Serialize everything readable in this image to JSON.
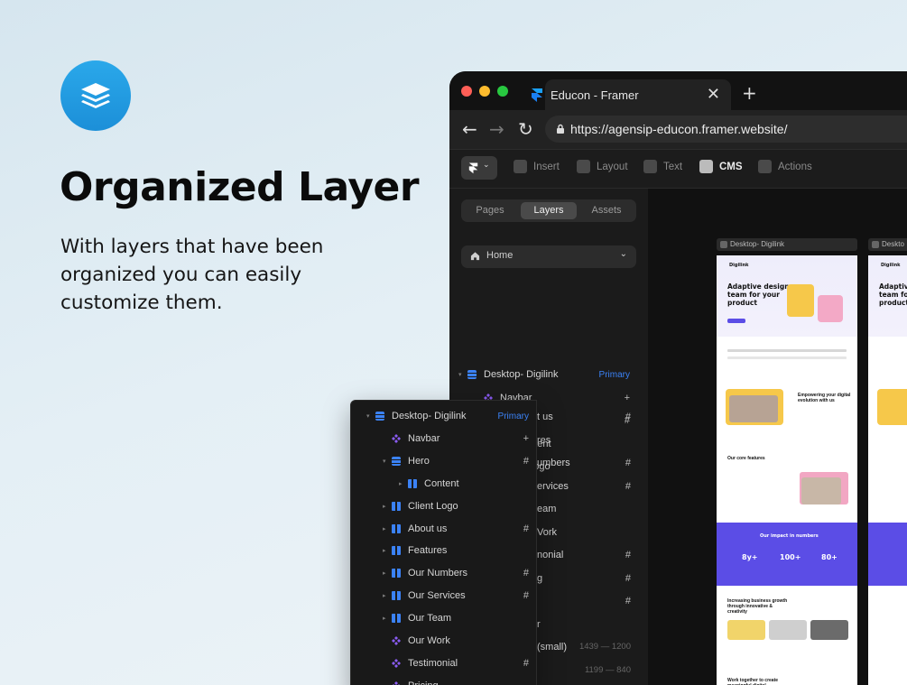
{
  "hero": {
    "logo_icon": "layers-icon",
    "headline": "Organized Layer",
    "subtext": "With layers that have been organized you can easily customize them."
  },
  "browser": {
    "tab_title": "Educon - Framer",
    "close": "✕",
    "new_tab": "+",
    "url": "https://agensip-educon.framer.website/",
    "traffic": [
      "#ff5f57",
      "#febc2e",
      "#28c840"
    ]
  },
  "toolbar": {
    "items": [
      {
        "label": "Insert",
        "icon": "plus-square-icon"
      },
      {
        "label": "Layout",
        "icon": "layout-icon"
      },
      {
        "label": "Text",
        "icon": "text-icon"
      },
      {
        "label": "CMS",
        "icon": "database-icon"
      },
      {
        "label": "Actions",
        "icon": "bolt-icon"
      }
    ]
  },
  "panel": {
    "tabs": [
      "Pages",
      "Layers",
      "Assets"
    ],
    "active_tab": "Layers",
    "page_select": "Home",
    "layers": [
      {
        "label": "Desktop- Digilink",
        "icon": "stack",
        "badge": "Primary",
        "caret": "▾",
        "indent": 0
      },
      {
        "label": "Navbar",
        "icon": "component",
        "right": "+",
        "indent": 1
      },
      {
        "label": "Hero",
        "icon": "stack",
        "right": "#",
        "caret": "▾",
        "indent": 1
      },
      {
        "label": "Content",
        "icon": "cols",
        "caret": "▸",
        "indent": 2
      },
      {
        "label": "Client Logo",
        "icon": "cols",
        "caret": "▸",
        "indent": 1
      }
    ],
    "under_fragments": [
      {
        "text": "t us",
        "right": "#"
      },
      {
        "text": "res",
        "right": ""
      },
      {
        "text": "umbers",
        "right": "#"
      },
      {
        "text": "ervices",
        "right": "#"
      },
      {
        "text": "eam",
        "right": ""
      },
      {
        "text": "Vork",
        "right": ""
      },
      {
        "text": "nonial",
        "right": "#"
      },
      {
        "text": "g",
        "right": "#"
      },
      {
        "text": "",
        "right": "#"
      },
      {
        "text": "r",
        "right": ""
      },
      {
        "text": "(small)",
        "right": "1439 — 1200"
      },
      {
        "text": "",
        "right": "1199 — 840"
      }
    ]
  },
  "canvas": {
    "frame_label_1": "Desktop- Digilink",
    "frame_label_2": "Deskto",
    "site_brand": "Digilink",
    "site_title": "Adaptive design team for your product",
    "section_1": "Empowering your digital evolution with us",
    "section_2": "Our core features",
    "band_title": "Our impact in numbers",
    "stats": [
      "8y+",
      "100+",
      "80+"
    ],
    "section_3": "Increasing business growth through innovative & creativity",
    "section_4": "Work together to create meaningful digital experiences"
  },
  "floating_panel": {
    "layers": [
      {
        "label": "Desktop- Digilink",
        "icon": "stack",
        "badge": "Primary",
        "caret": "▾",
        "indent": 0
      },
      {
        "label": "Navbar",
        "icon": "component",
        "right": "+",
        "indent": 1
      },
      {
        "label": "Hero",
        "icon": "stack",
        "right": "#",
        "caret": "▾",
        "indent": 1
      },
      {
        "label": "Content",
        "icon": "cols",
        "caret": "▸",
        "indent": 2
      },
      {
        "label": "Client Logo",
        "icon": "cols",
        "caret": "▸",
        "indent": 1
      },
      {
        "label": "About us",
        "icon": "cols",
        "right": "#",
        "caret": "▸",
        "indent": 1
      },
      {
        "label": "Features",
        "icon": "cols",
        "caret": "▸",
        "indent": 1
      },
      {
        "label": "Our Numbers",
        "icon": "cols",
        "right": "#",
        "caret": "▸",
        "indent": 1
      },
      {
        "label": "Our Services",
        "icon": "cols",
        "right": "#",
        "caret": "▸",
        "indent": 1
      },
      {
        "label": "Our Team",
        "icon": "cols",
        "caret": "▸",
        "indent": 1
      },
      {
        "label": "Our Work",
        "icon": "component",
        "indent": 1
      },
      {
        "label": "Testimonial",
        "icon": "component",
        "right": "#",
        "indent": 1
      },
      {
        "label": "Pricing",
        "icon": "component",
        "indent": 1
      }
    ]
  }
}
